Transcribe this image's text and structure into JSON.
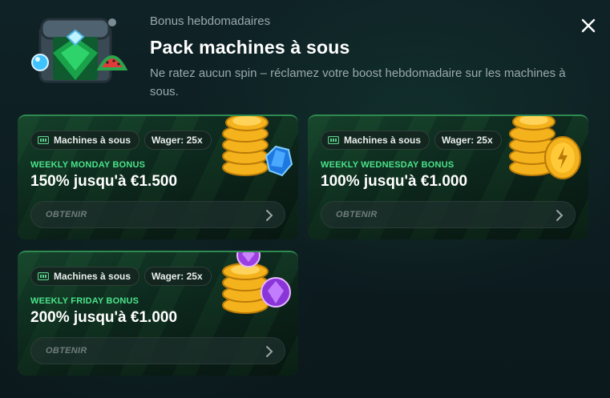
{
  "header": {
    "subtitle": "Bonus hebdomadaires",
    "title": "Pack machines à sous",
    "description": "Ne ratez aucun spin – réclamez votre boost hebdomadaire sur les machines à sous."
  },
  "cards": [
    {
      "chip_category": "Machines à sous",
      "chip_wager": "Wager: 25x",
      "label": "WEEKLY MONDAY BONUS",
      "amount": "150% jusqu'à €1.500",
      "cta": "OBTENIR"
    },
    {
      "chip_category": "Machines à sous",
      "chip_wager": "Wager: 25x",
      "label": "WEEKLY WEDNESDAY BONUS",
      "amount": "100% jusqu'à €1.000",
      "cta": "OBTENIR"
    },
    {
      "chip_category": "Machines à sous",
      "chip_wager": "Wager: 25x",
      "label": "WEEKLY FRIDAY BONUS",
      "amount": "200% jusqu'à €1.000",
      "cta": "OBTENIR"
    }
  ],
  "icons": {
    "header": "treasure-chest-icon",
    "close": "close-icon",
    "chip": "slot-machine-icon",
    "cta": "chevron-right-icon"
  },
  "colors": {
    "accent_green": "#4be38a",
    "card_border": "#2e8a4e",
    "background": "#0c1a1e",
    "coin_gold": "#f4b21c"
  }
}
